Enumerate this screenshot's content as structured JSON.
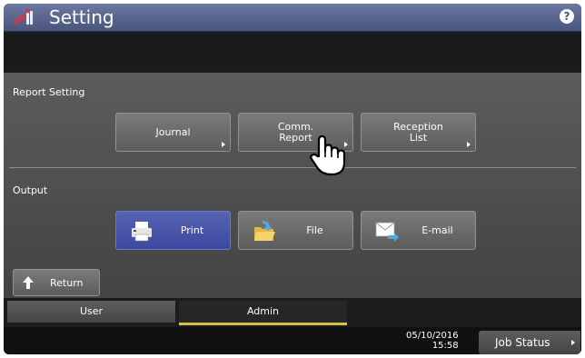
{
  "header": {
    "title": "Setting",
    "help_label": "?"
  },
  "report_setting": {
    "label": "Report Setting",
    "buttons": [
      "Journal",
      "Comm.\nReport",
      "Reception\nList"
    ]
  },
  "output": {
    "label": "Output",
    "buttons": [
      "Print",
      "File",
      "E-mail"
    ],
    "selected": "Print"
  },
  "return_label": "Return",
  "tabs": [
    "User",
    "Admin"
  ],
  "active_tab": "Admin",
  "status": {
    "date": "05/10/2016",
    "time": "15:58",
    "job_status_label": "Job Status"
  },
  "colors": {
    "selected_button": "#4a55aa",
    "tab_underline": "#d7c34a",
    "title_bar": "#5b6690"
  }
}
